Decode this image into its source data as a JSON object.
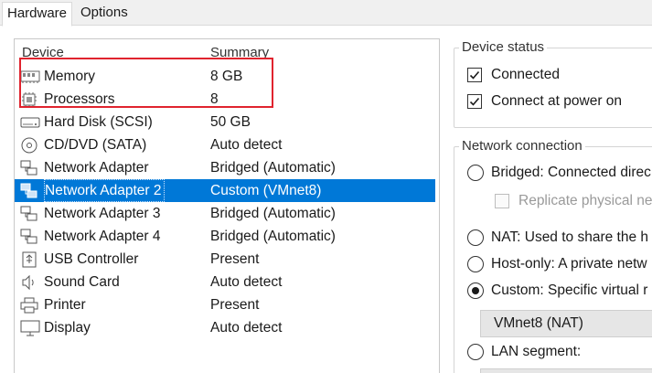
{
  "tabs": {
    "hardware": "Hardware",
    "options": "Options"
  },
  "device_list": {
    "col_device": "Device",
    "col_summary": "Summary",
    "rows": [
      {
        "name": "Memory",
        "summary": "8 GB",
        "icon": "memory-icon"
      },
      {
        "name": "Processors",
        "summary": "8",
        "icon": "processor-icon"
      },
      {
        "name": "Hard Disk (SCSI)",
        "summary": "50 GB",
        "icon": "hard-disk-icon"
      },
      {
        "name": "CD/DVD (SATA)",
        "summary": "Auto detect",
        "icon": "cd-dvd-icon"
      },
      {
        "name": "Network Adapter",
        "summary": "Bridged (Automatic)",
        "icon": "network-adapter-icon"
      },
      {
        "name": "Network Adapter 2",
        "summary": "Custom (VMnet8)",
        "icon": "network-adapter-icon",
        "selected": true
      },
      {
        "name": "Network Adapter 3",
        "summary": "Bridged (Automatic)",
        "icon": "network-adapter-icon"
      },
      {
        "name": "Network Adapter 4",
        "summary": "Bridged (Automatic)",
        "icon": "network-adapter-icon"
      },
      {
        "name": "USB Controller",
        "summary": "Present",
        "icon": "usb-icon"
      },
      {
        "name": "Sound Card",
        "summary": "Auto detect",
        "icon": "sound-icon"
      },
      {
        "name": "Printer",
        "summary": "Present",
        "icon": "printer-icon"
      },
      {
        "name": "Display",
        "summary": "Auto detect",
        "icon": "display-icon"
      }
    ]
  },
  "device_status": {
    "title": "Device status",
    "connected": "Connected",
    "connect_at_power_on": "Connect at power on"
  },
  "network_connection": {
    "title": "Network connection",
    "bridged": "Bridged: Connected direc",
    "replicate": "Replicate physical ne",
    "nat": "NAT: Used to share the h",
    "host_only": "Host-only: A private netw",
    "custom": "Custom: Specific virtual r",
    "custom_value": "VMnet8 (NAT)",
    "lan_segment": "LAN segment:"
  },
  "colors": {
    "selection": "#0078d7",
    "highlight_box": "#e0232e"
  }
}
